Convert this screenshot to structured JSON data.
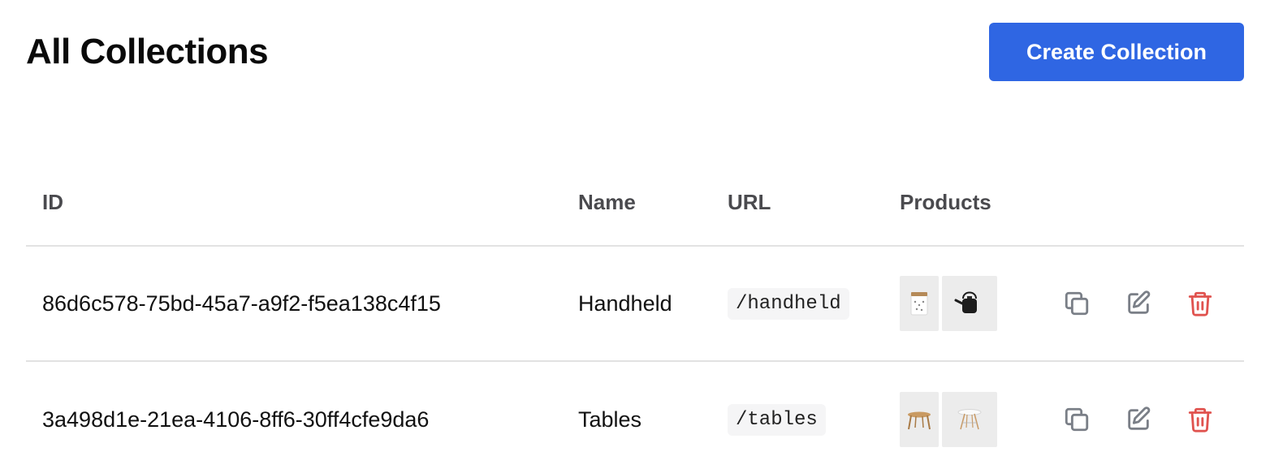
{
  "header": {
    "title": "All Collections",
    "create_button_label": "Create Collection"
  },
  "table": {
    "columns": [
      "ID",
      "Name",
      "URL",
      "Products"
    ],
    "rows": [
      {
        "id": "86d6c578-75bd-45a7-a9f2-f5ea138c4f15",
        "name": "Handheld",
        "url": "/handheld",
        "product_images": [
          "white-mug-image",
          "black-kettle-image"
        ]
      },
      {
        "id": "3a498d1e-21ea-4106-8ff6-30ff4cfe9da6",
        "name": "Tables",
        "url": "/tables",
        "product_images": [
          "wooden-stool-image",
          "white-round-table-image"
        ]
      }
    ]
  },
  "actions": {
    "icons": [
      "duplicate-icon",
      "edit-icon",
      "trash-icon"
    ]
  },
  "colors": {
    "primary": "#2f66e3",
    "danger": "#e0534f",
    "icon_gray": "#7a7f87",
    "border": "#e2e2e2"
  }
}
